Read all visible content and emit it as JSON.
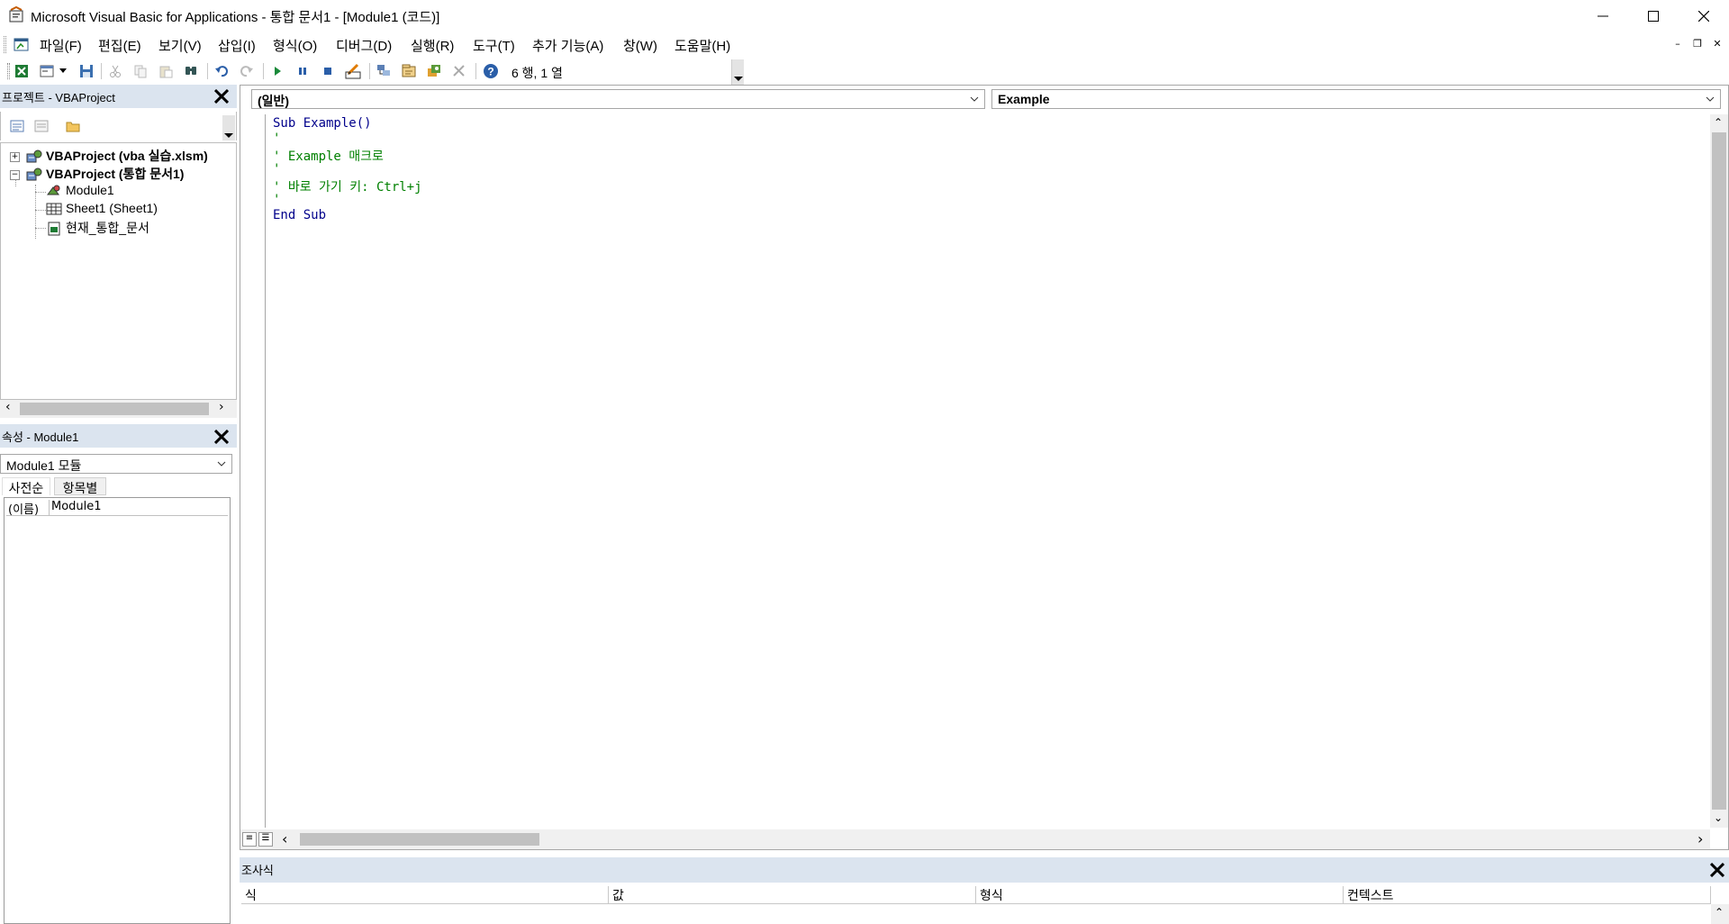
{
  "window": {
    "title": "Microsoft Visual Basic for Applications - 통합 문서1 - [Module1 (코드)]"
  },
  "menu": {
    "items": [
      "파일(F)",
      "편집(E)",
      "보기(V)",
      "삽입(I)",
      "형식(O)",
      "디버그(D)",
      "실행(R)",
      "도구(T)",
      "추가 기능(A)",
      "창(W)",
      "도움말(H)"
    ]
  },
  "toolbar": {
    "cursor_position": "6 행, 1 열",
    "icons": [
      "excel-icon",
      "insert-userform-icon",
      "save-icon",
      "cut-icon",
      "copy-icon",
      "paste-icon",
      "find-icon",
      "undo-icon",
      "redo-icon",
      "run-icon",
      "break-icon",
      "reset-icon",
      "design-mode-icon",
      "project-explorer-icon",
      "properties-icon",
      "object-browser-icon",
      "toolbox-icon",
      "help-icon"
    ]
  },
  "project_panel": {
    "title": "프로젝트 - VBAProject",
    "tree": [
      {
        "label": "VBAProject (vba 실습.xlsm)",
        "level": 0,
        "expanded": false
      },
      {
        "label": "VBAProject (통합 문서1)",
        "level": 0,
        "expanded": true
      },
      {
        "label": "Module1",
        "level": 1
      },
      {
        "label": "Sheet1 (Sheet1)",
        "level": 1
      },
      {
        "label": "현재_통합_문서",
        "level": 1
      }
    ]
  },
  "properties_panel": {
    "title": "속성 - Module1",
    "object_select": "Module1 모듈",
    "tabs": [
      "사전순",
      "항목별"
    ],
    "rows": [
      {
        "name": "(이름)",
        "value": "Module1"
      }
    ]
  },
  "code_window": {
    "object_dropdown": "(일반)",
    "procedure_dropdown": "Example",
    "lines": [
      {
        "text": "Sub Example()",
        "type": "kw"
      },
      {
        "text": "'",
        "type": "cm"
      },
      {
        "text": "' Example 매크로",
        "type": "cm"
      },
      {
        "text": "'",
        "type": "cm"
      },
      {
        "text": "' 바로 가기 키: Ctrl+j",
        "type": "cm"
      },
      {
        "text": "'",
        "type": "cm"
      },
      {
        "text": "End Sub",
        "type": "kw"
      }
    ]
  },
  "watch_panel": {
    "title": "조사식",
    "columns": [
      "식",
      "값",
      "형식",
      "컨텍스트"
    ]
  },
  "colors": {
    "panel_title_bg": "#dbe4ef",
    "keyword": "#00008b",
    "comment": "#008000"
  }
}
